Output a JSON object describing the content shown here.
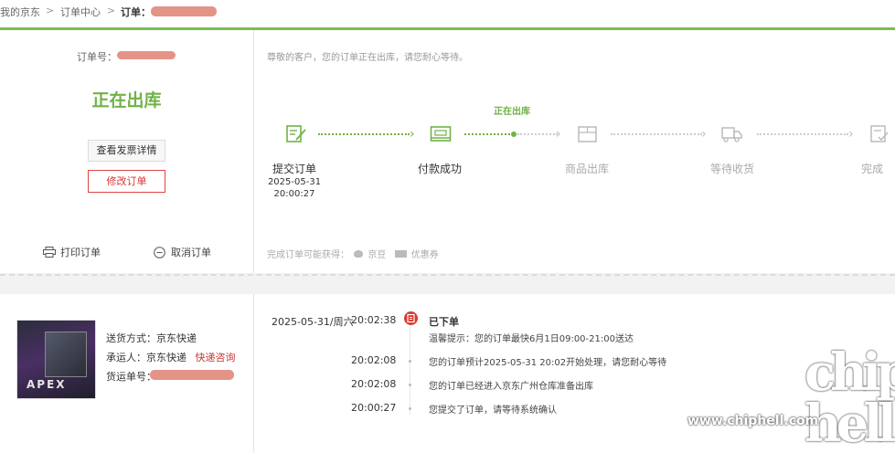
{
  "breadcrumb": {
    "home": "我的京东",
    "orders": "订单中心",
    "current": "订单：",
    "sep": ">"
  },
  "summary": {
    "order_no_label": "订单号：",
    "status": "正在出库",
    "invoice_button": "查看发票详情",
    "modify_button": "修改订单",
    "print_link": "打印订单",
    "cancel_link": "取消订单"
  },
  "progress": {
    "notice": "尊敬的客户，您的订单正在出库，请您耐心等待。",
    "current_label": "正在出库",
    "steps": [
      {
        "label": "提交订单",
        "icon": "submit-order-icon",
        "state": "done"
      },
      {
        "label": "付款成功",
        "icon": "payment-card-icon",
        "state": "done"
      },
      {
        "label": "商品出库",
        "icon": "package-icon",
        "state": "todo"
      },
      {
        "label": "等待收货",
        "icon": "truck-icon",
        "state": "todo"
      },
      {
        "label": "完成",
        "icon": "complete-icon",
        "state": "todo"
      }
    ],
    "submit_date": "2025-05-31",
    "submit_time": "20:00:27",
    "earn_label": "完成订单可能获得：",
    "earn_items": [
      "京豆",
      "优惠券"
    ],
    "colors": {
      "done": "#71b247",
      "todo": "#cccccc"
    }
  },
  "shipping": {
    "method_label": "送货方式：",
    "method": "京东快递",
    "carrier_label": "承运人：",
    "carrier": "京东快递",
    "inquiry_link": "快递咨询",
    "tracking_label": "货运单号：",
    "product_text": "APEX"
  },
  "log": [
    {
      "date": "2025-05-31/周六",
      "time": "20:02:38",
      "title": "已下单",
      "text": "温馨提示：您的订单最快6月1日09:00-21:00送达"
    },
    {
      "date": "",
      "time": "20:02:08",
      "title": "",
      "text": "您的订单预计2025-05-31 20:02开始处理，请您耐心等待"
    },
    {
      "date": "",
      "time": "20:02:08",
      "title": "",
      "text": "您的订单已经进入京东广州仓库准备出库"
    },
    {
      "date": "",
      "time": "20:00:27",
      "title": "",
      "text": "您提交了订单，请等待系统确认"
    }
  ],
  "watermark": {
    "url": "www.chiphell.com",
    "logo": "chip hell"
  }
}
